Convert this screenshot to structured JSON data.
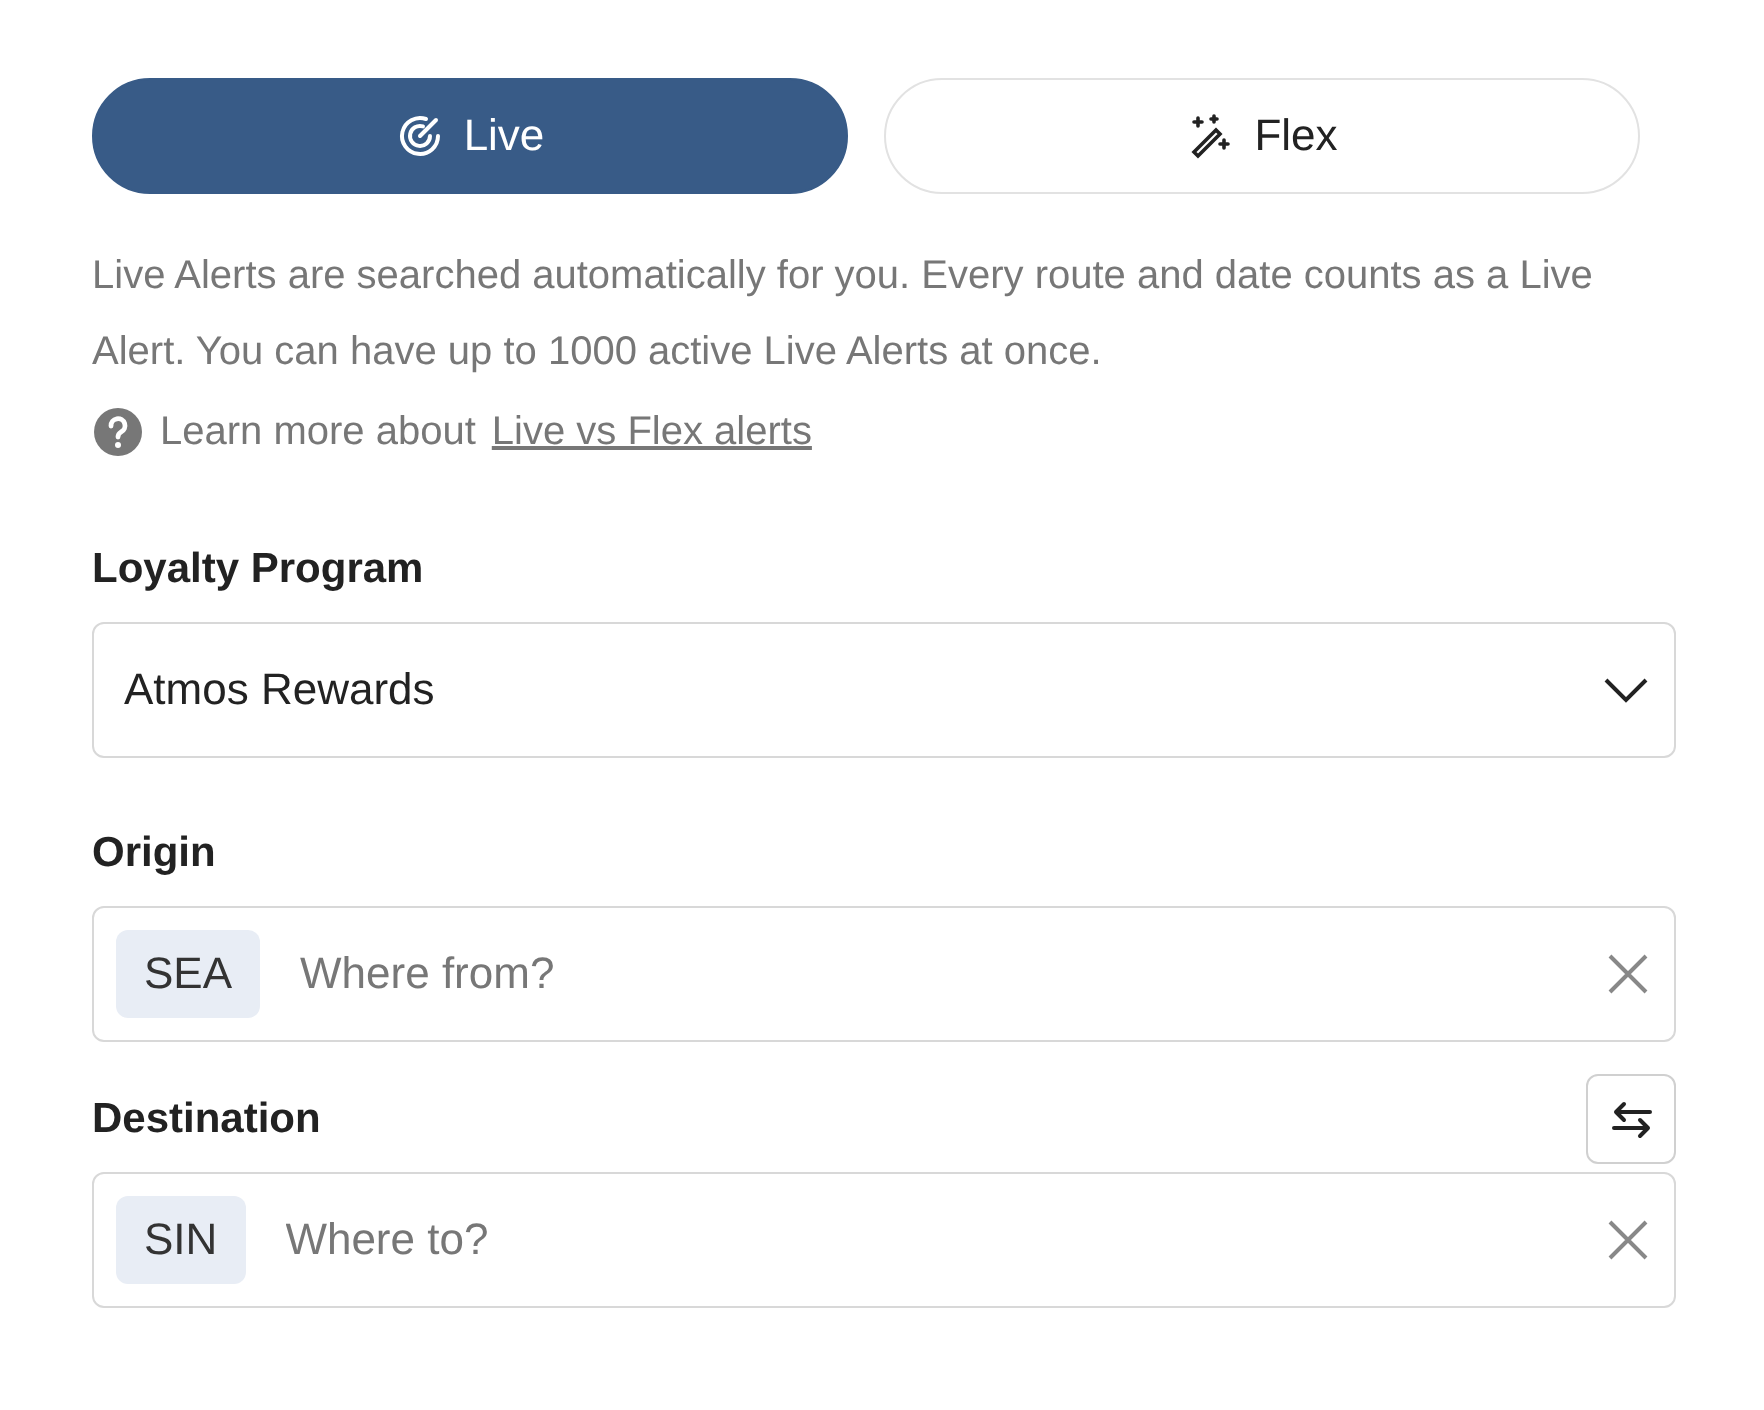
{
  "tabs": [
    {
      "label": "Live",
      "selected": true
    },
    {
      "label": "Flex",
      "selected": false
    }
  ],
  "description": "Live Alerts are searched automatically for you. Every route and date counts as a Live Alert. You can have up to 1000 active Live Alerts at once.",
  "learn_more": {
    "text": "Learn more about",
    "link": "Live vs Flex alerts"
  },
  "loyalty_program": {
    "label": "Loyalty Program",
    "value": "Atmos Rewards"
  },
  "origin": {
    "label": "Origin",
    "code": "SEA",
    "placeholder": "Where from?"
  },
  "destination": {
    "label": "Destination",
    "code": "SIN",
    "placeholder": "Where to?"
  }
}
